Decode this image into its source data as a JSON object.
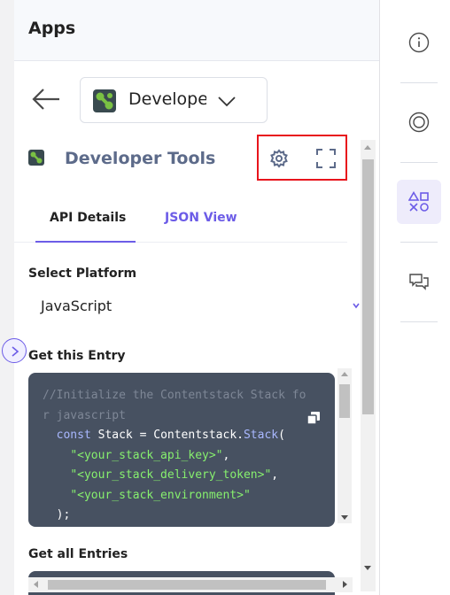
{
  "panel": {
    "header_title": "Apps",
    "app_selector": {
      "selected": "Developer Tools",
      "visible_text": "Develope"
    },
    "tool_title": "Developer Tools",
    "tabs": [
      {
        "label": "API Details",
        "active": true
      },
      {
        "label": "JSON View",
        "active": false
      }
    ],
    "select_platform_label": "Select Platform",
    "platform_value": "JavaScript",
    "get_entry_label": "Get this Entry",
    "get_entries_label": "Get all Entries",
    "code": {
      "comment_line1": "//Initialize the Contentstack Stack fo",
      "comment_line2": "r javascript",
      "kw_const": "const",
      "stack_assign": " Stack = Contentstack.",
      "fn_stack": "Stack",
      "open_paren": "(",
      "arg1": "\"<your_stack_api_key>\"",
      "arg2": "\"<your_stack_delivery_token>\"",
      "arg3": "\"<your_stack_environment>\"",
      "comma": ",",
      "close": ");"
    }
  },
  "icons": {
    "back": "arrow-left-icon",
    "chevron": "chevron-down-icon",
    "settings": "gear-icon",
    "fullscreen": "fullscreen-icon",
    "copy": "copy-icon",
    "collapse": "chevron-right-icon",
    "info": "info-icon",
    "activity": "circle-ring-icon",
    "apps": "shapes-icon",
    "discussion": "chat-bubbles-icon"
  },
  "colors": {
    "accent": "#6c5ce7",
    "highlight_box": "#e8141c",
    "code_background": "#475161",
    "code_string": "#87f06e",
    "code_keyword": "#a9b8ff",
    "app_icon_green": "#7ac143"
  }
}
